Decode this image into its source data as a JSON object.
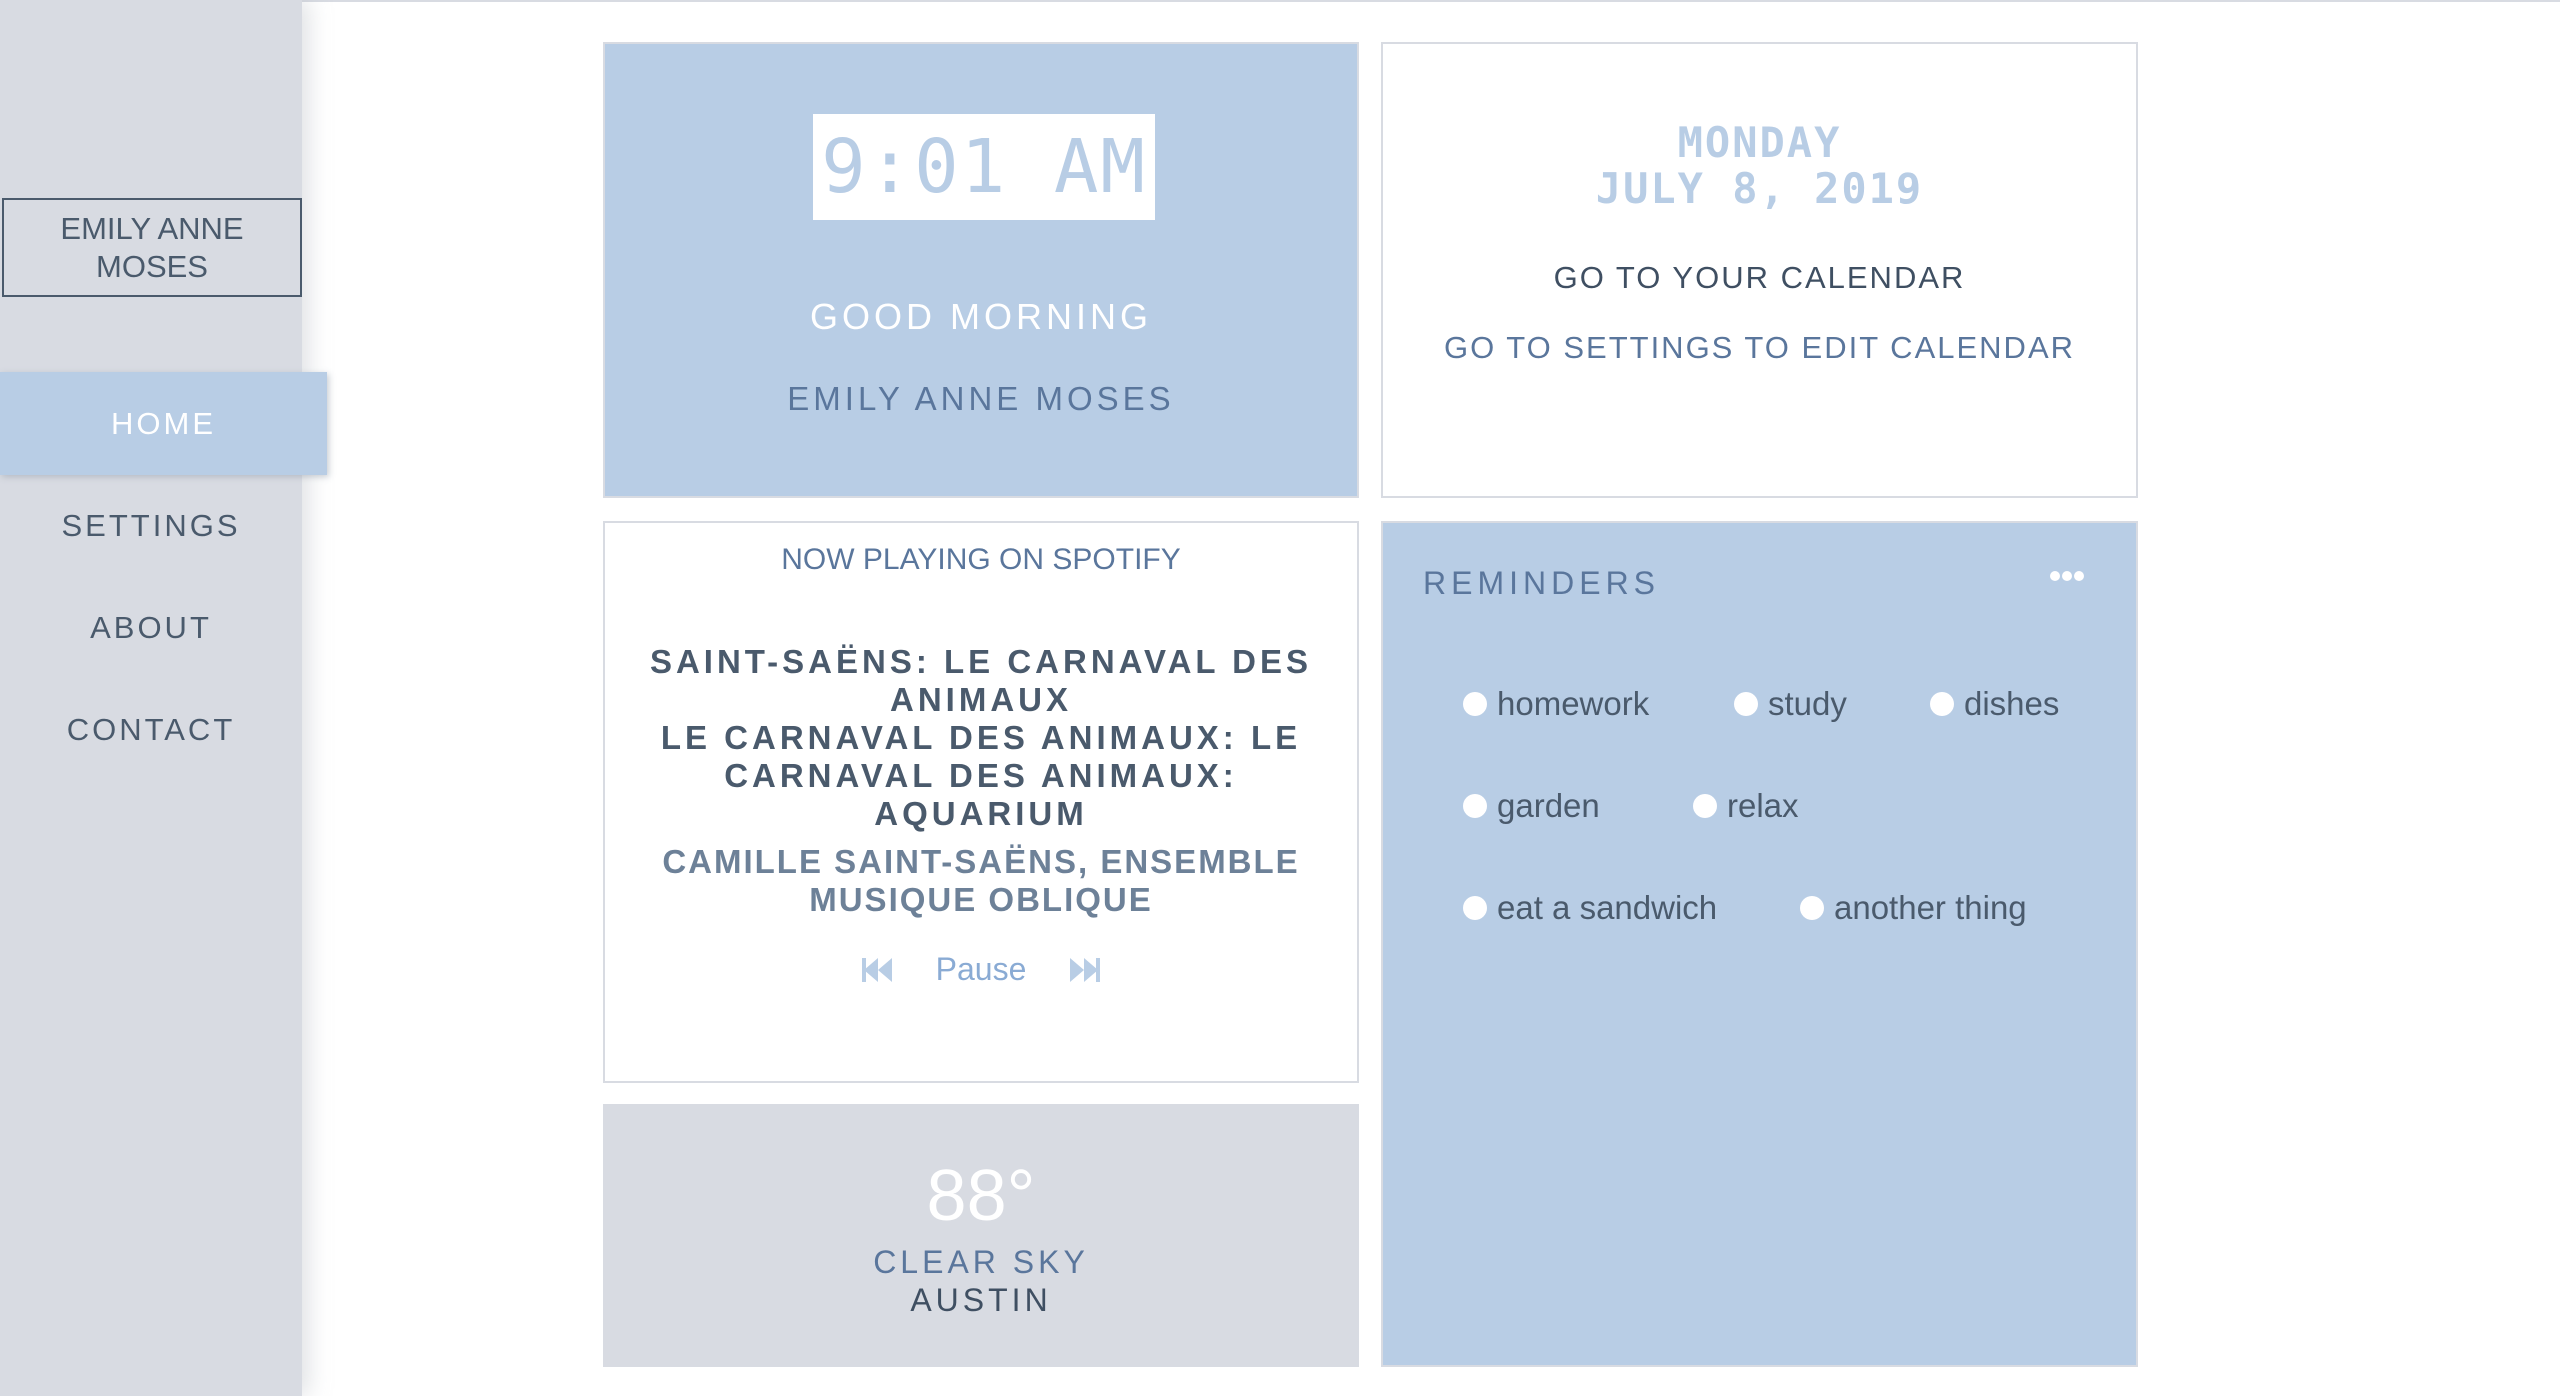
{
  "sidebar": {
    "user_name": "EMILY ANNE MOSES",
    "nav": [
      {
        "label": "HOME",
        "active": true
      },
      {
        "label": "SETTINGS",
        "active": false
      },
      {
        "label": "ABOUT",
        "active": false
      },
      {
        "label": "CONTACT",
        "active": false
      }
    ]
  },
  "clock": {
    "time": "9:01 AM",
    "greeting": "GOOD MORNING",
    "name": "EMILY ANNE MOSES"
  },
  "calendar": {
    "day": "MONDAY",
    "date": "JULY 8, 2019",
    "go_to_calendar": "GO TO YOUR CALENDAR",
    "edit_calendar": "GO TO SETTINGS TO EDIT CALENDAR"
  },
  "spotify": {
    "header": "NOW PLAYING ON SPOTIFY",
    "track": "SAINT-SAËNS: LE CARNAVAL DES ANIMAUX LE CARNAVAL DES ANIMAUX: LE CARNAVAL DES ANIMAUX: AQUARIUM",
    "track_line1": "SAINT-SAËNS: LE CARNAVAL DES ANIMAUX",
    "track_line2": "LE CARNAVAL DES ANIMAUX: LE CARNAVAL DES ANIMAUX: AQUARIUM",
    "artist": "CAMILLE SAINT-SAËNS, ENSEMBLE MUSIQUE OBLIQUE",
    "controls": {
      "previous_icon": "rewind-icon",
      "pause_label": "Pause",
      "next_icon": "fast-forward-icon"
    }
  },
  "weather": {
    "temperature": "88°",
    "condition": "CLEAR SKY",
    "city": "AUSTIN"
  },
  "reminders": {
    "title": "REMINDERS",
    "menu_icon": "more-horizontal-icon",
    "rows": [
      [
        "homework",
        "study",
        "dishes"
      ],
      [
        "garden",
        "relax"
      ],
      [
        "eat a sandwich",
        "another thing"
      ]
    ]
  },
  "colors": {
    "accent_blue": "#b8cde5",
    "sidebar_grey": "#d8dbe2",
    "text_dark": "#4a5a6c",
    "text_blue": "#5a769c"
  }
}
